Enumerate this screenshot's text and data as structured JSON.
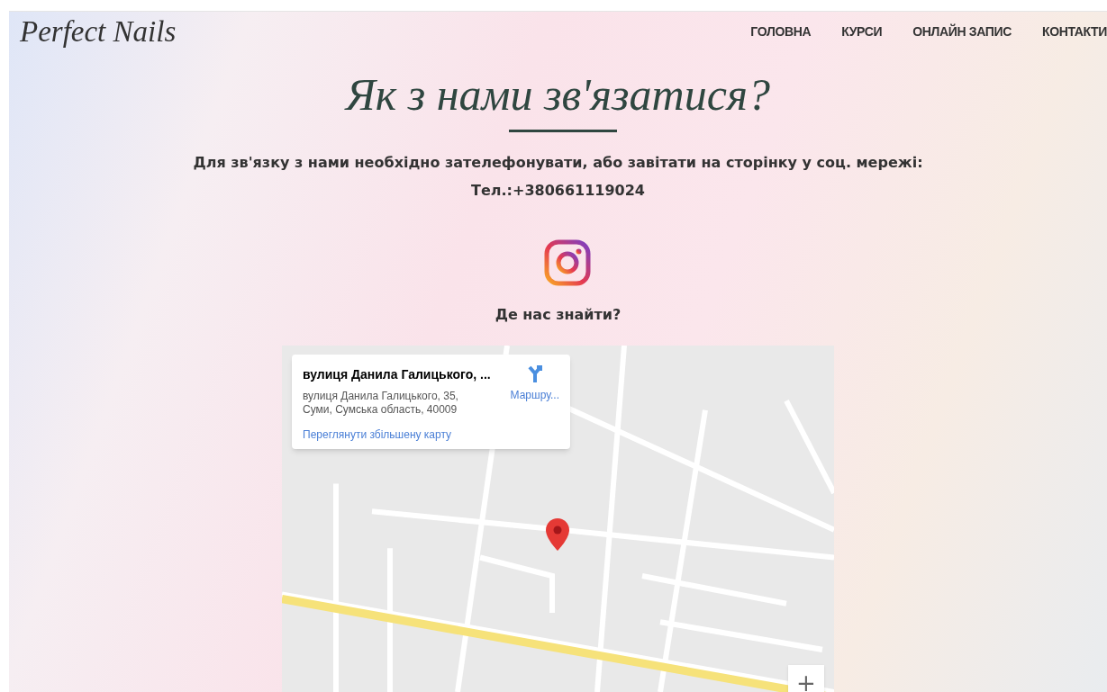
{
  "header": {
    "logo": "Perfect Nails",
    "nav": [
      {
        "label": "ГОЛОВНА"
      },
      {
        "label": "КУРСИ"
      },
      {
        "label": "ОНЛАЙН ЗАПИС"
      },
      {
        "label": "КОНТАКТИ"
      }
    ]
  },
  "title": "Як з нами зв'язатися?",
  "intro": "Для зв'язку з нами необхідно зателефонувати, або завітати на сторінку у соц. мережі:",
  "phone": "Тел.:+380661119024",
  "find_heading": "Де нас знайти?",
  "map": {
    "card": {
      "title": "вулиця Данила Галицького, ...",
      "address_line_1": "вулиця Данила Галицького, 35,",
      "address_line_2": "Суми, Сумська область, 40009",
      "directions": "Маршру...",
      "larger_map_link": "Переглянути збільшену карту"
    },
    "zoom_in": "+"
  }
}
